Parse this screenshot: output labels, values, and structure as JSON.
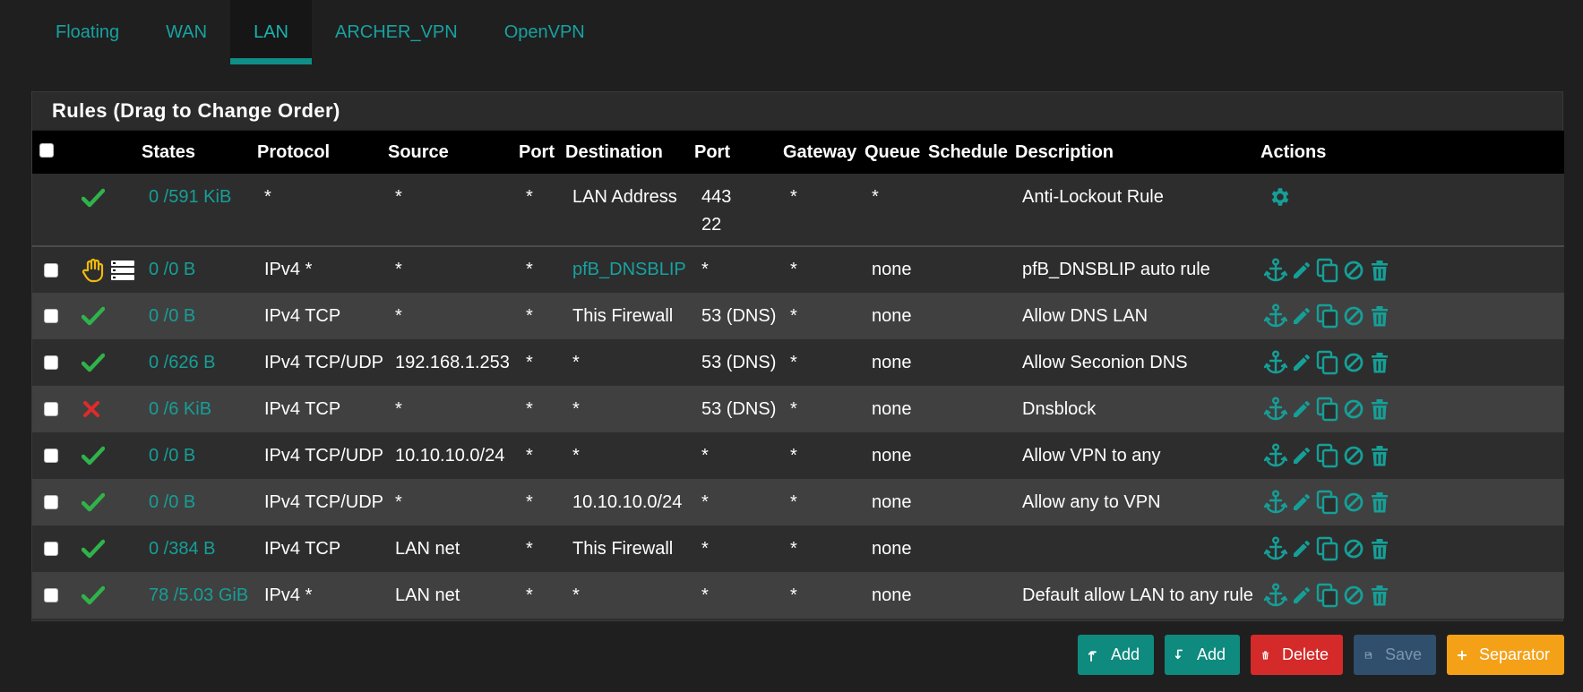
{
  "tabs": [
    {
      "label": "Floating"
    },
    {
      "label": "WAN"
    },
    {
      "label": "LAN"
    },
    {
      "label": "ARCHER_VPN"
    },
    {
      "label": "OpenVPN"
    }
  ],
  "active_tab": "LAN",
  "panel": {
    "title": "Rules (Drag to Change Order)"
  },
  "columns": {
    "states": "States",
    "protocol": "Protocol",
    "source": "Source",
    "port": "Port",
    "destination": "Destination",
    "dest_port": "Port",
    "gateway": "Gateway",
    "queue": "Queue",
    "schedule": "Schedule",
    "description": "Description",
    "actions": "Actions"
  },
  "anti_lockout": {
    "states": "0 /591 KiB",
    "protocol": "*",
    "source": "*",
    "port": "*",
    "destination": "LAN Address",
    "dest_port_1": "443",
    "dest_port_2": "22",
    "gateway": "*",
    "queue": "*",
    "schedule": "",
    "description": "Anti-Lockout Rule",
    "icon": "gear-icon"
  },
  "rows": [
    {
      "status": "hand-block",
      "states": "0 /0 B",
      "protocol": "IPv4 *",
      "source": "*",
      "port": "*",
      "destination": "pfB_DNSBLIP",
      "dest_port": "*",
      "gateway": "*",
      "queue": "none",
      "schedule": "",
      "description": "pfB_DNSBLIP auto rule"
    },
    {
      "status": "pass",
      "states": "0 /0 B",
      "protocol": "IPv4 TCP",
      "source": "*",
      "port": "*",
      "destination": "This Firewall",
      "dest_port": "53 (DNS)",
      "gateway": "*",
      "queue": "none",
      "schedule": "",
      "description": "Allow DNS LAN"
    },
    {
      "status": "pass",
      "states": "0 /626 B",
      "protocol": "IPv4 TCP/UDP",
      "source": "192.168.1.253",
      "port": "*",
      "destination": "*",
      "dest_port": "53 (DNS)",
      "gateway": "*",
      "queue": "none",
      "schedule": "",
      "description": "Allow Seconion DNS"
    },
    {
      "status": "block",
      "states": "0 /6 KiB",
      "protocol": "IPv4 TCP",
      "source": "*",
      "port": "*",
      "destination": "*",
      "dest_port": "53 (DNS)",
      "gateway": "*",
      "queue": "none",
      "schedule": "",
      "description": "Dnsblock"
    },
    {
      "status": "pass",
      "states": "0 /0 B",
      "protocol": "IPv4 TCP/UDP",
      "source": "10.10.10.0/24",
      "port": "*",
      "destination": "*",
      "dest_port": "*",
      "gateway": "*",
      "queue": "none",
      "schedule": "",
      "description": "Allow VPN to any"
    },
    {
      "status": "pass",
      "states": "0 /0 B",
      "protocol": "IPv4 TCP/UDP",
      "source": "*",
      "port": "*",
      "destination": "10.10.10.0/24",
      "dest_port": "*",
      "gateway": "*",
      "queue": "none",
      "schedule": "",
      "description": "Allow any to VPN"
    },
    {
      "status": "pass",
      "states": "0 /384 B",
      "protocol": "IPv4 TCP",
      "source": "LAN net",
      "port": "*",
      "destination": "This Firewall",
      "dest_port": "*",
      "gateway": "*",
      "queue": "none",
      "schedule": "",
      "description": ""
    },
    {
      "status": "pass",
      "states": "78 /5.03 GiB",
      "protocol": "IPv4 *",
      "source": "LAN net",
      "port": "*",
      "destination": "*",
      "dest_port": "*",
      "gateway": "*",
      "queue": "none",
      "schedule": "",
      "description": "Default allow LAN to any rule"
    }
  ],
  "buttons": {
    "add_top": "Add",
    "add_bottom": "Add",
    "delete": "Delete",
    "save": "Save",
    "separator": "Separator"
  },
  "colors": {
    "accent": "#159f97",
    "pass": "#2fb34b",
    "block": "#e02b2b",
    "hand": "#f0b90b",
    "delete": "#d42a2a",
    "save": "#2f4f6d",
    "separator": "#f4a118"
  }
}
